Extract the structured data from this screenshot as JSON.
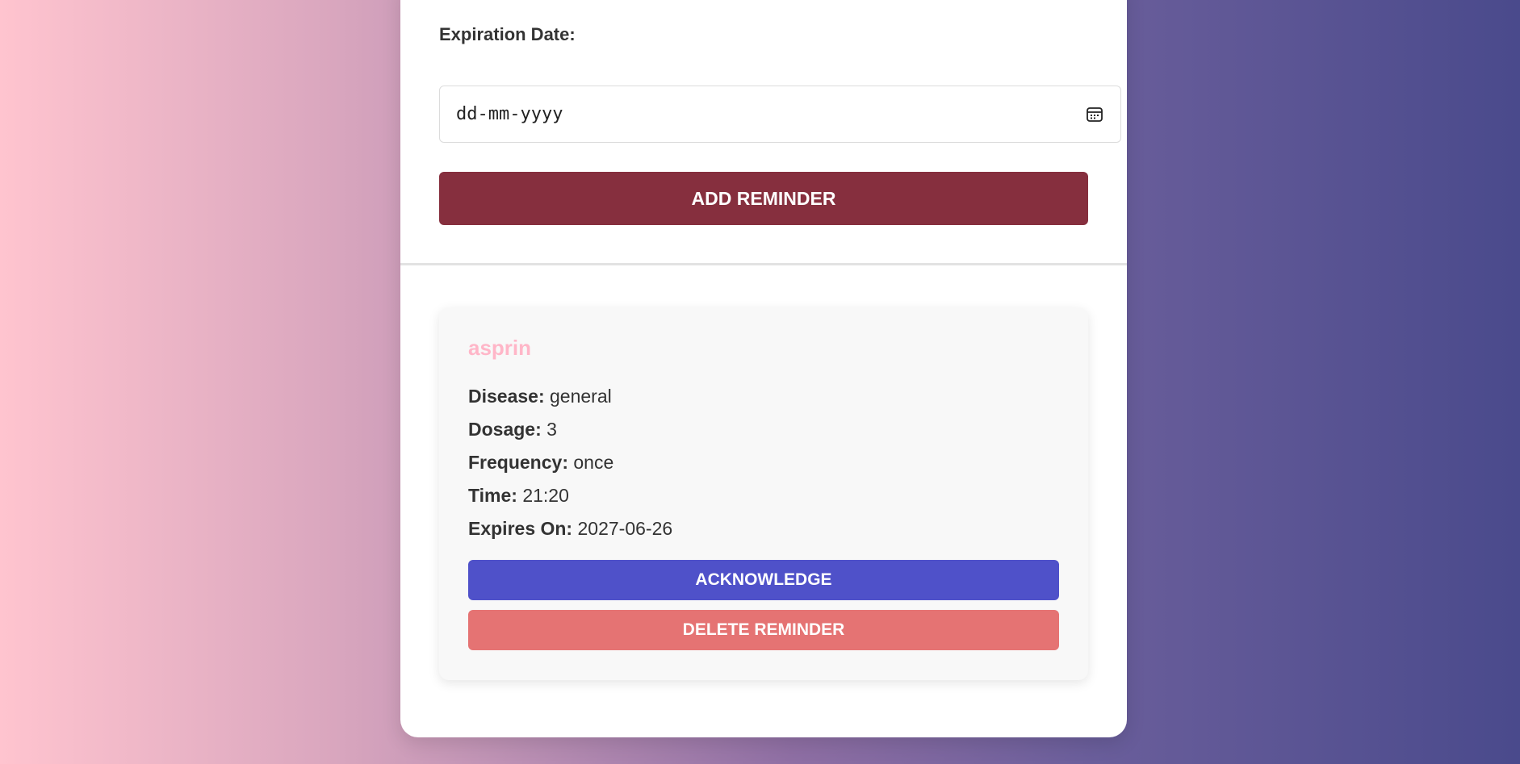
{
  "form": {
    "expiration_label": "Expiration Date:",
    "date_placeholder": "dd-mm-yyyy",
    "add_button_label": "ADD REMINDER"
  },
  "reminder": {
    "name": "asprin",
    "fields": [
      {
        "key": "Disease:",
        "value": "general"
      },
      {
        "key": "Dosage:",
        "value": "3"
      },
      {
        "key": "Frequency:",
        "value": "once"
      },
      {
        "key": "Time:",
        "value": "21:20"
      },
      {
        "key": "Expires On:",
        "value": "2027-06-26"
      }
    ],
    "acknowledge_label": "ACKNOWLEDGE",
    "delete_label": "DELETE REMINDER"
  },
  "colors": {
    "add_button": "#862f3e",
    "acknowledge_button": "#4f51c9",
    "delete_button": "#e57373",
    "med_name": "#ffb6c8"
  },
  "icons": {
    "date_picker": "calendar-icon"
  }
}
